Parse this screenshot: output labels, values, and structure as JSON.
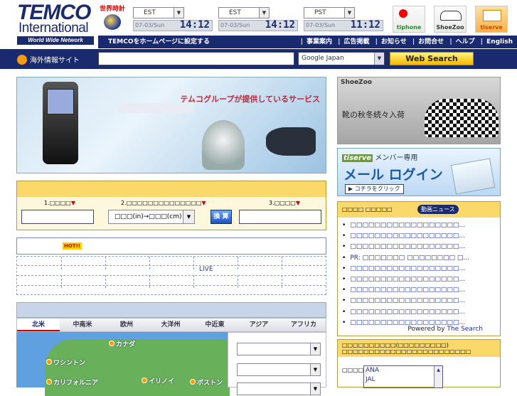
{
  "logo": {
    "brand": "TEMCO",
    "sub": "International",
    "tagline": "World Wide Network Services"
  },
  "clock": {
    "label": "世界時計",
    "zones": [
      {
        "zone": "EST",
        "date": "07-03/Sun",
        "time": "14:12"
      },
      {
        "zone": "EST",
        "date": "07-03/Sun",
        "time": "14:12"
      },
      {
        "zone": "PST",
        "date": "07-03/Sun",
        "time": "11:12"
      }
    ],
    "dropdown_glyph": "▼"
  },
  "partner_icons": [
    "tiphone",
    "ShoeZoo",
    "tiserve"
  ],
  "nav": {
    "home": "TEMCOをホームページに設定する",
    "links": [
      "事業案内",
      "広告掲載",
      "お知らせ",
      "お問合せ",
      "ヘルプ",
      "English"
    ],
    "separator": "|"
  },
  "search": {
    "overseas": "海外情報サイト",
    "engine": "Google Japan",
    "button": "Web Search"
  },
  "banner": {
    "title": "テムコグループが提供しているサービス"
  },
  "shoezoo": {
    "brand": "ShoeZoo",
    "text": "靴の秋冬続々入荷"
  },
  "tiserve": {
    "brand": "tiserve",
    "members": "メンバー専用",
    "title": "メール ログイン",
    "click": "コチラをクリック"
  },
  "converter": {
    "label1": "1.□□□□",
    "label2": "2.□□□□□□□□□□□□□□",
    "label3": "3.□□□□",
    "marker": "▼",
    "unit_select": "□□□(in)→□□□(cm)",
    "go": "換 算"
  },
  "hot": {
    "badge": "HOT!!"
  },
  "live": {
    "label": "LIVE"
  },
  "regions": [
    "北米",
    "中南米",
    "欧州",
    "大洋州",
    "中近東",
    "アジア",
    "アフリカ"
  ],
  "map_pins": [
    "カナダ",
    "ワシントン",
    "カリフォルニア",
    "イリノイ",
    "ボストン"
  ],
  "news": {
    "title": "□□□□ □□□□□",
    "pill": "動画ニュース",
    "items": [
      "□□□□□□□□□□□□□□□□□□...",
      "□□□□□□□□□□□□□□□□□□...",
      "□□□□□□□□□□□□□□□□□□...",
      "PR: □□□□□□□ □□□□□□□□ □...",
      "□□□□□□□□□□□□□□□□□□...",
      "□□□□□□□□□□□□□□□□□□...",
      "□□□□□□□□□□□□□□□□□□...",
      "□□□□□□□□□□□□□□□□□□...",
      "□□□□□□□□□□□□□□□□□□...",
      "□□□□□□□□□□□□□□□□□□..."
    ],
    "powered_prefix": "Powered by",
    "powered_by": "The Search"
  },
  "flight": {
    "header": "□□□□□□□□□□(□□□□□□□□□)",
    "subheader": "□□□□□□□□□□□□□□□□□□□□□□□□",
    "label": "□□□□",
    "options": [
      "ANA",
      "JAL"
    ]
  }
}
